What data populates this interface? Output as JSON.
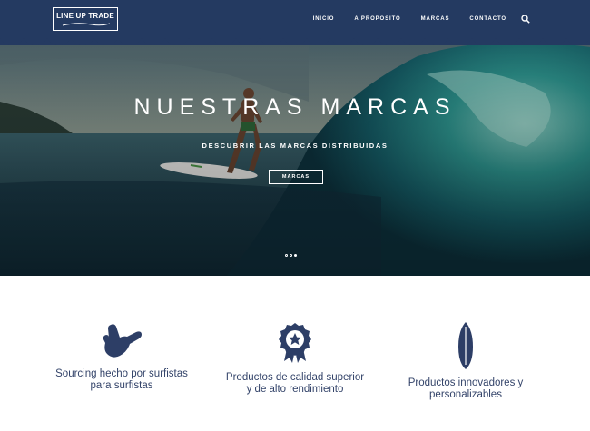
{
  "header": {
    "logo_text": "LINE UP TRADE",
    "nav": [
      "INICIO",
      "A PROPÓSITO",
      "MARCAS",
      "CONTACTO"
    ],
    "search_icon": "search-icon",
    "background": "#243a61"
  },
  "hero": {
    "title": "NUESTRAS MARCAS",
    "subtitle": "DESCUBRIR LAS MARCAS DISTRIBUIDAS",
    "button": "MARCAS",
    "slides": 3,
    "active_slide": 3
  },
  "features": [
    {
      "icon": "shaka-hand-icon",
      "text_line1": "Sourcing hecho por surfistas",
      "text_line2": "para surfistas"
    },
    {
      "icon": "award-ribbon-icon",
      "text_line1": "Productos de calidad superior",
      "text_line2": "y de alto rendimiento"
    },
    {
      "icon": "surfboard-icon",
      "text_line1": "Productos innovadores y",
      "text_line2": "personalizables"
    }
  ],
  "colors": {
    "brand_navy": "#243a61",
    "icon_navy": "#2d3e66",
    "text": "#34446a"
  }
}
